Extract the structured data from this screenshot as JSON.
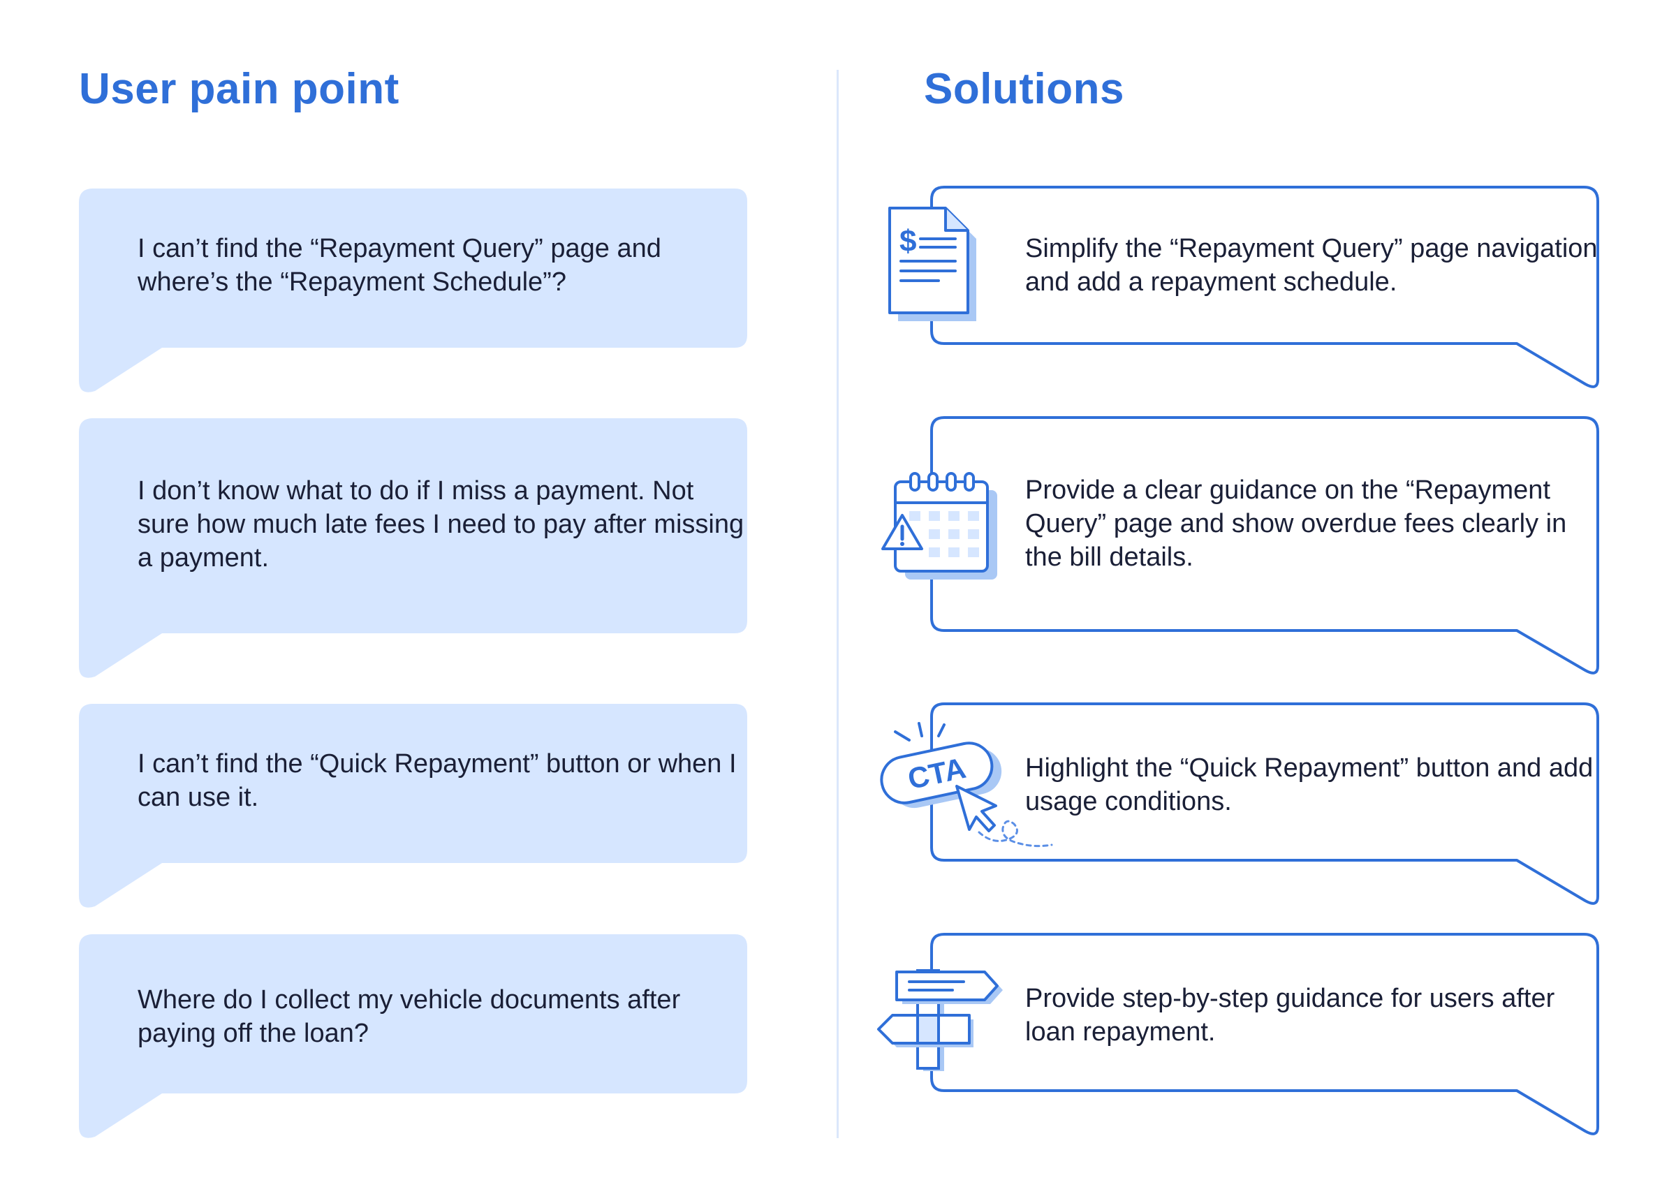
{
  "headings": {
    "left": "User pain point",
    "right": "Solutions"
  },
  "pain_points": [
    "I can’t find the “Repayment Query” page and where’s the “Repayment Schedule”?",
    "I don’t know what to do if I miss a payment. Not sure how much late fees I need to pay after missing a payment.",
    "I can’t find the “Quick Repayment” button or when I can use it.",
    "Where do I collect my vehicle documents after paying off the loan?"
  ],
  "solutions": [
    {
      "text": "Simplify the “Repayment Query” page navigation and add a repayment schedule.",
      "icon": "document-dollar-icon"
    },
    {
      "text": "Provide a clear guidance on the “Repayment Query” page and show overdue fees clearly in the bill details.",
      "icon": "calendar-warning-icon"
    },
    {
      "text": "Highlight the “Quick Repayment” button and add usage conditions.",
      "icon": "cta-button-cursor-icon"
    },
    {
      "text": "Provide step-by-step guidance for users after loan repayment.",
      "icon": "signpost-icon"
    }
  ],
  "icon_labels": {
    "dollar": "$",
    "cta": "CTA"
  },
  "colors": {
    "accent": "#2f6fd8",
    "bubble_fill": "#d6e6ff",
    "shadow": "#a9c8f5",
    "text": "#1a1f36"
  }
}
